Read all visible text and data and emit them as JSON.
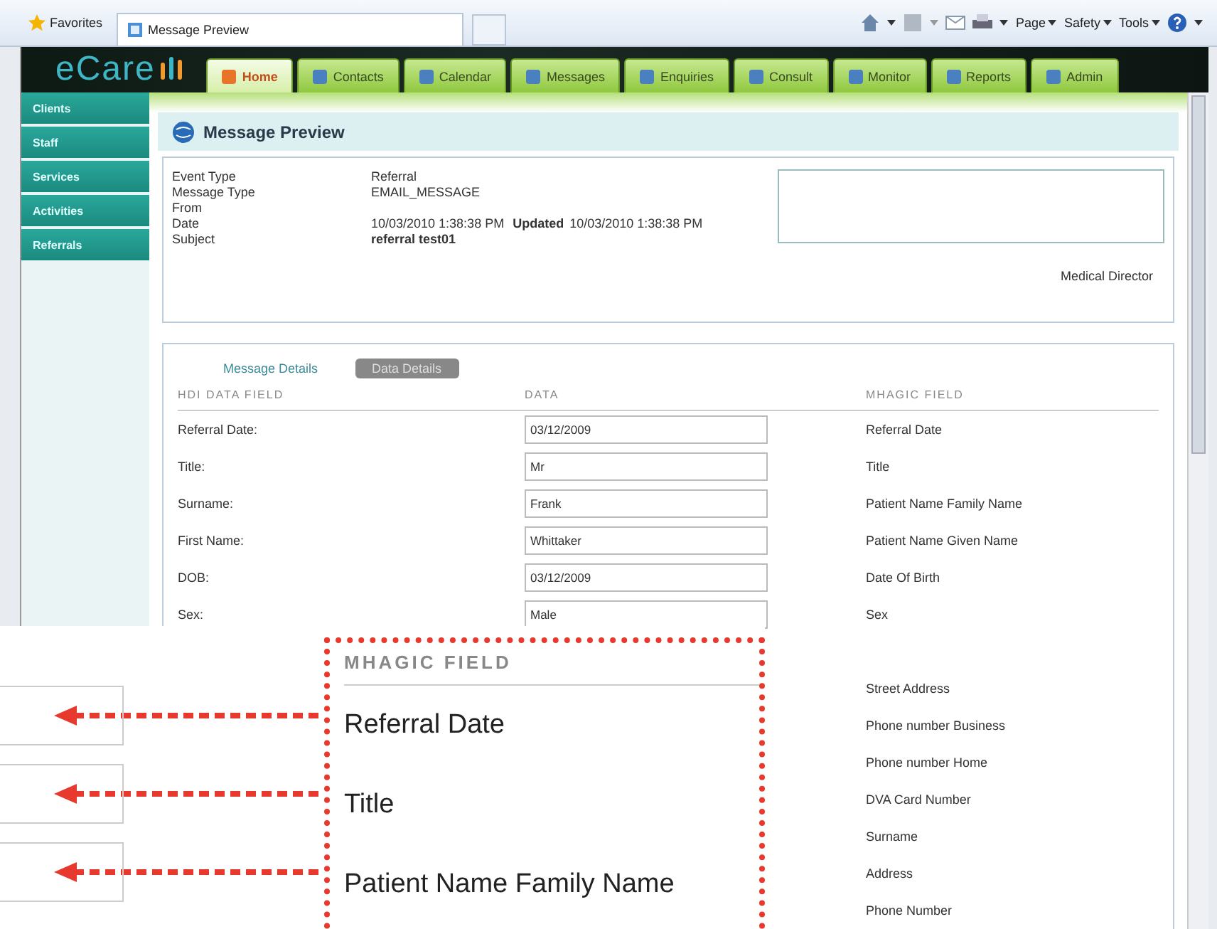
{
  "browser": {
    "favorites": "Favorites",
    "tab_title": "Message Preview",
    "commands": [
      "Page",
      "Safety",
      "Tools"
    ]
  },
  "app": {
    "logo": "eCare",
    "tabs": [
      {
        "label": "Home",
        "selected": true
      },
      {
        "label": "Contacts",
        "selected": false
      },
      {
        "label": "Calendar",
        "selected": false
      },
      {
        "label": "Messages",
        "selected": false
      },
      {
        "label": "Enquiries",
        "selected": false
      },
      {
        "label": "Consult",
        "selected": false
      },
      {
        "label": "Monitor",
        "selected": false
      },
      {
        "label": "Reports",
        "selected": false
      },
      {
        "label": "Admin",
        "selected": false
      }
    ],
    "sidebar": [
      "Clients",
      "Staff",
      "Services",
      "Activities",
      "Referrals"
    ]
  },
  "page_title": "Message Preview",
  "message": {
    "fields": [
      {
        "label": "Event Type",
        "value": "Referral"
      },
      {
        "label": "Message Type",
        "value": "EMAIL_MESSAGE"
      },
      {
        "label": "From"
      },
      {
        "label": "Date",
        "value": "10/03/2010 1:38:38 PM",
        "updated_label": "Updated",
        "updated": "10/03/2010 1:38:38 PM"
      },
      {
        "label": "Subject",
        "value": "referral test01"
      }
    ],
    "signature": "Medical Director"
  },
  "detail_tabs": [
    {
      "label": "Message Details",
      "selected": false
    },
    {
      "label": "Data Details",
      "selected": true
    }
  ],
  "table": {
    "columns": [
      "HDI DATA FIELD",
      "DATA",
      "MHAGIC FIELD"
    ],
    "rows": [
      {
        "field": "Referral Date:",
        "data": "03/12/2009",
        "magic": "Referral Date"
      },
      {
        "field": "Title:",
        "data": "Mr",
        "magic": "Title"
      },
      {
        "field": "Surname:",
        "data": "Frank",
        "magic": "Patient Name Family Name"
      },
      {
        "field": "First Name:",
        "data": "Whittaker",
        "magic": "Patient Name Given Name"
      },
      {
        "field": "DOB:",
        "data": "03/12/2009",
        "magic": "Date Of Birth"
      },
      {
        "field": "Sex:",
        "data": "Male",
        "magic": "Sex"
      }
    ],
    "more_magic_fields": [
      "Street Address",
      "Phone number Business",
      "Phone number Home",
      "DVA Card Number",
      "Surname",
      "Address",
      "Phone Number"
    ]
  },
  "callout": {
    "heading": "MHAGIC FIELD",
    "items": [
      "Referral Date",
      "Title",
      "Patient Name Family Name"
    ]
  }
}
